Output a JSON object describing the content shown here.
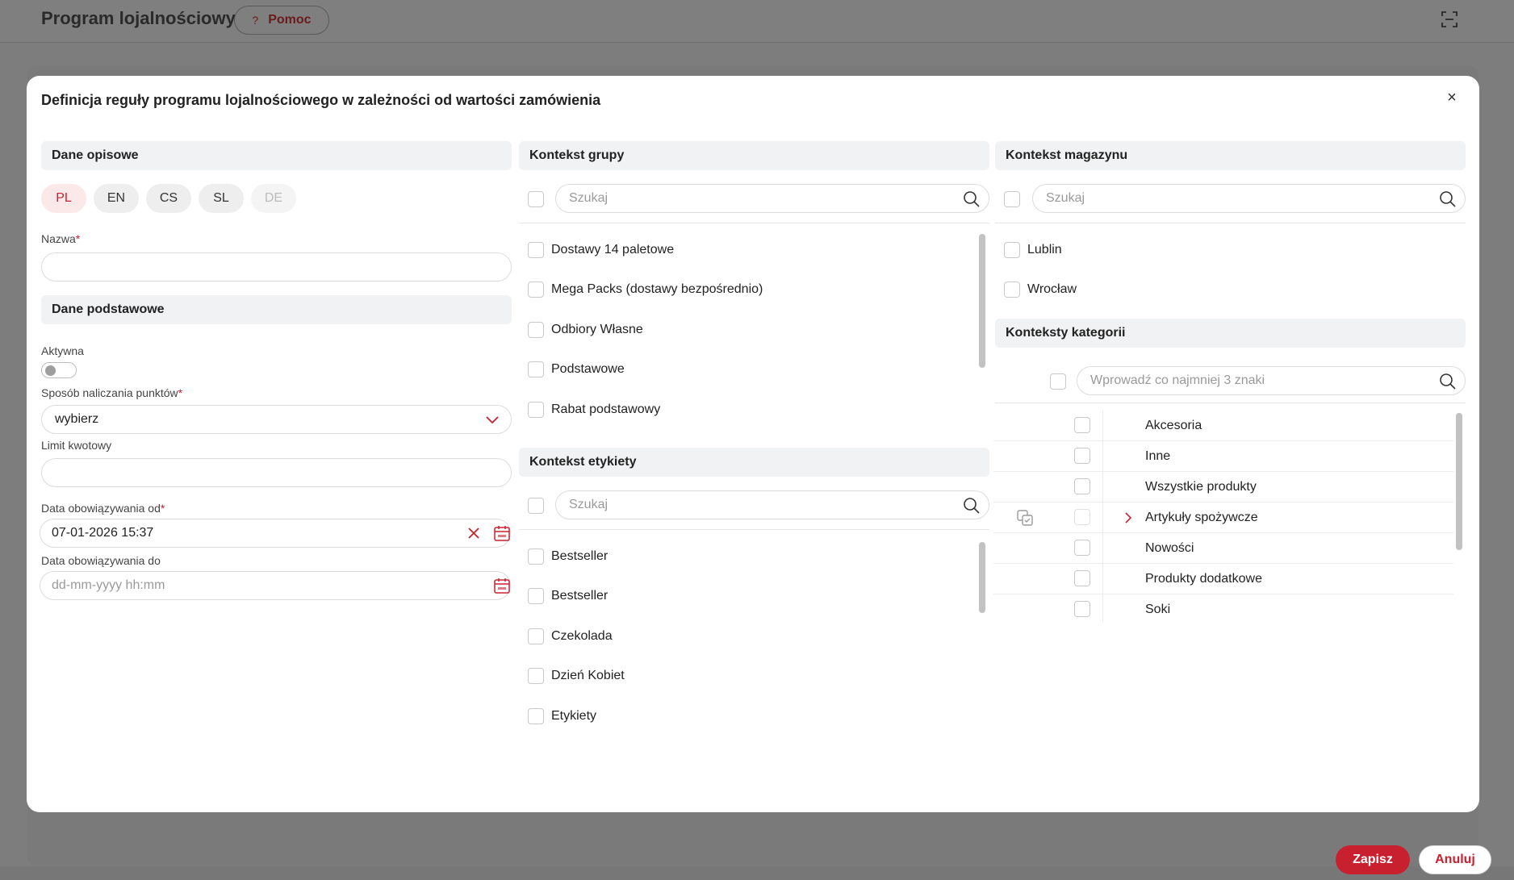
{
  "app": {
    "title": "Program lojalnościowy",
    "help_label": "Pomoc",
    "help_icon": "?"
  },
  "modal": {
    "title": "Definicja reguły programu lojalnościowego w zależności od wartości zamówienia",
    "close_icon": "×"
  },
  "descriptive": {
    "header": "Dane opisowe",
    "languages": [
      "PL",
      "EN",
      "CS",
      "SL",
      "DE"
    ],
    "active_language": "PL",
    "name_label": "Nazwa",
    "name_value": ""
  },
  "basic": {
    "header": "Dane podstawowe",
    "active_label": "Aktywna",
    "active_value": false,
    "points_method_label": "Sposób naliczania punktów",
    "points_method_value": "wybierz",
    "amount_limit_label": "Limit kwotowy",
    "amount_limit_value": "",
    "valid_from_label": "Data obowiązywania od",
    "valid_from_value": "07-01-2026 15:37",
    "valid_to_label": "Data obowiązywania do",
    "valid_to_placeholder": "dd-mm-yyyy hh:mm"
  },
  "group_context": {
    "header": "Kontekst grupy",
    "search_placeholder": "Szukaj",
    "items": [
      "Dostawy 14 paletowe",
      "Mega Packs (dostawy bezpośrednio)",
      "Odbiory Własne",
      "Podstawowe",
      "Rabat podstawowy"
    ]
  },
  "label_context": {
    "header": "Kontekst etykiety",
    "search_placeholder": "Szukaj",
    "items": [
      "Bestseller",
      "Bestseller",
      "Czekolada",
      "Dzień Kobiet",
      "Etykiety"
    ]
  },
  "warehouse_context": {
    "header": "Kontekst magazynu",
    "search_placeholder": "Szukaj",
    "items": [
      "Lublin",
      "Wrocław"
    ]
  },
  "category_context": {
    "header": "Konteksty kategorii",
    "search_placeholder": "Wprowadź co najmniej 3 znaki",
    "items": [
      "Akcesoria",
      "Inne",
      "Wszystkie produkty",
      "Artykuły spożywcze",
      "Nowości",
      "Produkty dodatkowe",
      "Soki"
    ]
  },
  "footer": {
    "save_label": "Zapisz",
    "cancel_label": "Anuluj"
  },
  "colors": {
    "accent": "#c8202f",
    "accent_light": "#fbe9ea",
    "section_bg": "#f1f2f3",
    "overlay": "#7d7d7d"
  }
}
